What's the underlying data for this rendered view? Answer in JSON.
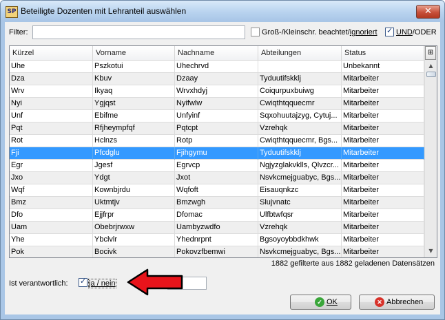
{
  "window": {
    "app_icon_text": "SP",
    "title": "Beteiligte Dozenten mit Lehranteil auswählen",
    "close_glyph": "✕"
  },
  "filter": {
    "label": "Filter:",
    "value": "",
    "case_checkbox_checked": false,
    "case_label_pre": "Groß-/Kleinschr. beachtet/",
    "case_label_underlined": "ignoriert",
    "andor_checkbox_checked": true,
    "andor_label_underlined": "UND",
    "andor_label_post": "/ODER"
  },
  "table": {
    "columns": [
      "Kürzel",
      "Vorname",
      "Nachname",
      "Abteilungen",
      "Status"
    ],
    "selected_row_index": 7,
    "rows": [
      [
        "Uhe",
        "Pszkotui",
        "Uhechrvd",
        "",
        "Unbekannt"
      ],
      [
        "Dza",
        "Kbuv",
        "Dzaay",
        "Tyduutifskklj",
        "Mitarbeiter"
      ],
      [
        "Wrv",
        "Ikyaq",
        "Wrvxhdyj",
        "Coiqurpuxbuiwg",
        "Mitarbeiter"
      ],
      [
        "Nyi",
        "Ygjqst",
        "Nyifwlw",
        "Cwiqthtqquecmr",
        "Mitarbeiter"
      ],
      [
        "Unf",
        "Ebifme",
        "Unfyinf",
        "Sqxohuutajzyg, Cytuj...",
        "Mitarbeiter"
      ],
      [
        "Pqt",
        "Rfjheympfqf",
        "Pqtcpt",
        "Vzrehqk",
        "Mitarbeiter"
      ],
      [
        "Rot",
        "Hclnzs",
        "Rotp",
        "Cwiqthtqquecmr, Bgs...",
        "Mitarbeiter"
      ],
      [
        "Fji",
        "Pfcdglu",
        "Fjihgymu",
        "Tyduutifskklj",
        "Mitarbeiter"
      ],
      [
        "Egr",
        "Jgesf",
        "Egrvcp",
        "Ngjyzglakvklls, Qlvzcr...",
        "Mitarbeiter"
      ],
      [
        "Jxo",
        "Ydgt",
        "Jxot",
        "Nsvkcmejguabyc, Bgs...",
        "Mitarbeiter"
      ],
      [
        "Wqf",
        "Kownbjrdu",
        "Wqfoft",
        "Eisauqnkzc",
        "Mitarbeiter"
      ],
      [
        "Bmz",
        "Uktmtjv",
        "Bmzwgh",
        "Slujvnatc",
        "Mitarbeiter"
      ],
      [
        "Dfo",
        "Ejjfrpr",
        "Dfomac",
        "Ulfbtwfqsr",
        "Mitarbeiter"
      ],
      [
        "Uam",
        "Obebrjrwxw",
        "Uambyzwdfo",
        "Vzrehqk",
        "Mitarbeiter"
      ],
      [
        "Yhe",
        "Ybclvlr",
        "Yhednrpnt",
        "Bgsoyoybbdkhwk",
        "Mitarbeiter"
      ],
      [
        "Pok",
        "Bocivk",
        "Pokovzfbemwi",
        "Nsvkcmejguabyc, Bgs...",
        "Mitarbeiter"
      ]
    ],
    "column_chooser_glyph": "⊞",
    "scroll_up_glyph": "▲",
    "scroll_down_glyph": "▼"
  },
  "status_text": "1882 gefilterte aus 1882 geladenen Datensätzen",
  "responsible": {
    "label": "Ist verantwortlich:",
    "checkbox_checked": true,
    "option_text": "ja / nein",
    "input_value": ""
  },
  "buttons": {
    "ok_label": "OK",
    "cancel_label": "Abbrechen",
    "ok_icon": "✓",
    "cancel_icon": "✕"
  },
  "colors": {
    "selection": "#3399ff",
    "arrow_fill": "#e8141b",
    "ok_icon_bg": "#3aa63a",
    "cancel_icon_bg": "#d8322a"
  }
}
